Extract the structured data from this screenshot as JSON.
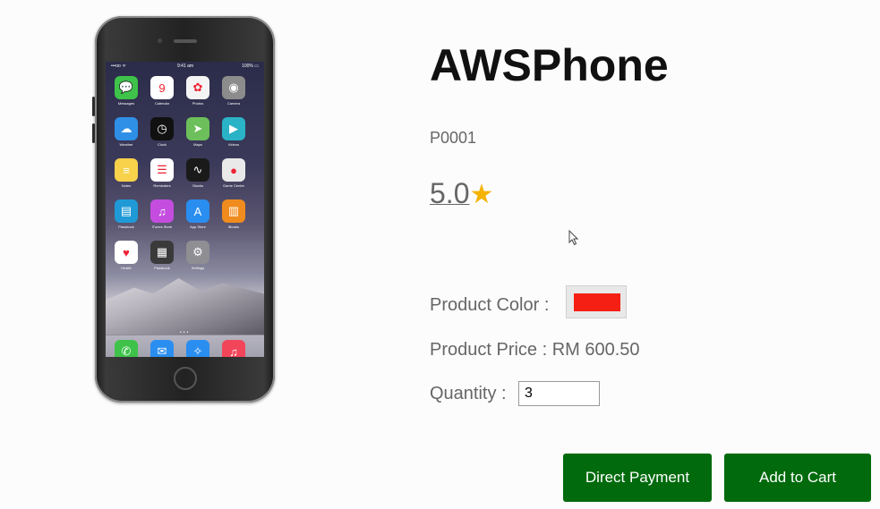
{
  "product": {
    "name": "AWSPhone",
    "code": "P0001",
    "rating": "5.0",
    "rating_star": "★",
    "color_label": "Product Color :",
    "color_value": "#f51f14",
    "price_label": "Product Price : RM 600.50",
    "quantity_label": "Quantity :",
    "quantity_value": "3"
  },
  "actions": {
    "direct_payment": "Direct Payment",
    "add_to_cart": "Add to Cart"
  },
  "phone_image": {
    "status_left": "•••oo ᯤ",
    "status_center": "9:41 am",
    "status_right": "100% ▭",
    "apps": [
      {
        "label": "Messages",
        "icon": "message-icon",
        "color": "#3ec24a",
        "glyph": "💬"
      },
      {
        "label": "Calendar",
        "icon": "calendar-icon",
        "color": "#ffffff",
        "glyph": "9"
      },
      {
        "label": "Photos",
        "icon": "photos-icon",
        "color": "#f4f4f4",
        "glyph": "✿"
      },
      {
        "label": "Camera",
        "icon": "camera-icon",
        "color": "#8c8c8c",
        "glyph": "◉"
      },
      {
        "label": "Weather",
        "icon": "weather-icon",
        "color": "#2f8fe6",
        "glyph": "☁"
      },
      {
        "label": "Clock",
        "icon": "clock-icon",
        "color": "#111111",
        "glyph": "◷"
      },
      {
        "label": "Maps",
        "icon": "maps-icon",
        "color": "#6cbf5a",
        "glyph": "➤"
      },
      {
        "label": "Videos",
        "icon": "videos-icon",
        "color": "#2ab3c7",
        "glyph": "▶"
      },
      {
        "label": "Notes",
        "icon": "notes-icon",
        "color": "#f7d24a",
        "glyph": "≡"
      },
      {
        "label": "Reminders",
        "icon": "reminders-icon",
        "color": "#ffffff",
        "glyph": "☰"
      },
      {
        "label": "Stocks",
        "icon": "stocks-icon",
        "color": "#1a1a1a",
        "glyph": "∿"
      },
      {
        "label": "Game Center",
        "icon": "game-center-icon",
        "color": "#e9e9e9",
        "glyph": "●"
      },
      {
        "label": "Passbook",
        "icon": "passbook-icon",
        "color": "#1f9ad6",
        "glyph": "▤"
      },
      {
        "label": "iTunes Store",
        "icon": "itunes-icon",
        "color": "#c44de0",
        "glyph": "♫"
      },
      {
        "label": "App Store",
        "icon": "app-store-icon",
        "color": "#2a8df0",
        "glyph": "A"
      },
      {
        "label": "iBooks",
        "icon": "ibooks-icon",
        "color": "#f08c1e",
        "glyph": "▥"
      },
      {
        "label": "Health",
        "icon": "health-icon",
        "color": "#ffffff",
        "glyph": "♥"
      },
      {
        "label": "Passbook",
        "icon": "wallet-icon",
        "color": "#3a3a3a",
        "glyph": "▦"
      },
      {
        "label": "Settings",
        "icon": "settings-icon",
        "color": "#8e8e93",
        "glyph": "⚙"
      }
    ],
    "dock": [
      {
        "label": "Phone",
        "icon": "phone-icon",
        "color": "#3ec24a",
        "glyph": "✆"
      },
      {
        "label": "Mail",
        "icon": "mail-icon",
        "color": "#2a8df0",
        "glyph": "✉"
      },
      {
        "label": "Safari",
        "icon": "safari-icon",
        "color": "#2a8df0",
        "glyph": "✧"
      },
      {
        "label": "Music",
        "icon": "music-icon",
        "color": "#f2455a",
        "glyph": "♫"
      }
    ]
  }
}
